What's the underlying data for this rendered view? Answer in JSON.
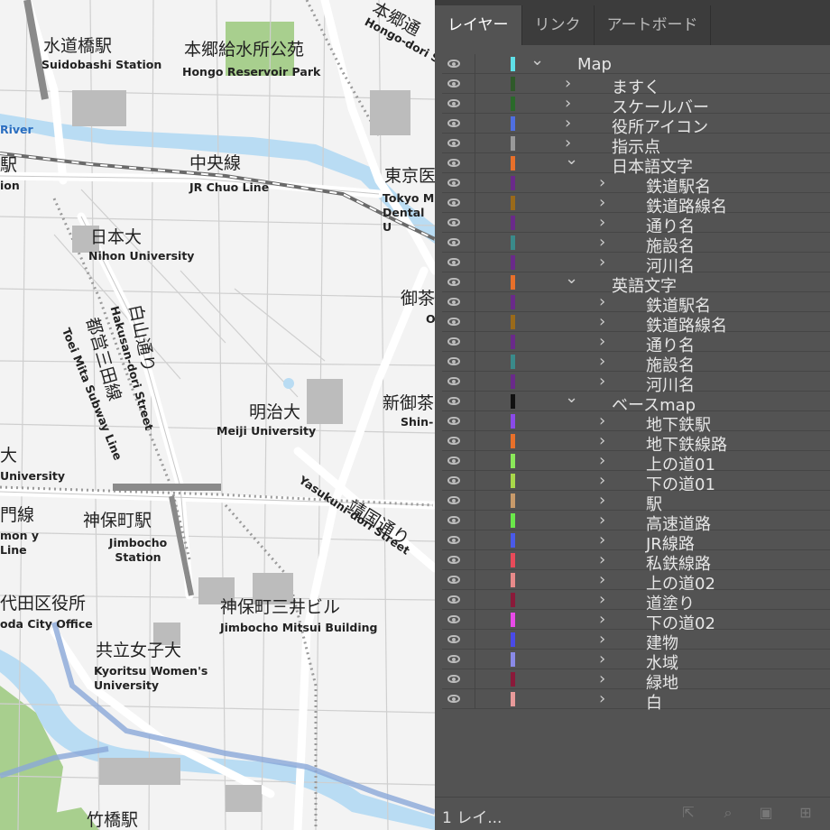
{
  "map": {
    "labels": [
      {
        "jp": "水道橋駅",
        "en": "Suidobashi Station"
      },
      {
        "jp": "本郷給水所公苑",
        "en": "Hongo Reservoir Park"
      },
      {
        "jp": "本郷通",
        "en": "Hongo-dori S"
      },
      {
        "jp": "中央線",
        "en": "JR Chuo Line"
      },
      {
        "jp": "東京医",
        "en": "Tokyo M Dental U"
      },
      {
        "jp": "日本大",
        "en": "Nihon University"
      },
      {
        "jp": "白山通り",
        "en": "Hakusan-dori Street"
      },
      {
        "jp": "都営三田線",
        "en": "Toei Mita Subway Line"
      },
      {
        "jp": "明治大",
        "en": "Meiji University"
      },
      {
        "jp": "御茶",
        "en": "O"
      },
      {
        "jp": "新御茶",
        "en": "Shin-"
      },
      {
        "jp": "靖国通り",
        "en": "Yasukuni-dori Street"
      },
      {
        "jp": "神保町駅",
        "en": "Jimbocho Station"
      },
      {
        "jp": "神保町三井ビル",
        "en": "Jimbocho Mitsui Building"
      },
      {
        "jp": "代田区役所",
        "en": "oda City Office"
      },
      {
        "jp": "共立女子大",
        "en": "Kyoritsu Women's University"
      },
      {
        "jp": "竹橋駅",
        "en": ""
      },
      {
        "jp": "門線",
        "en": "mon y Line"
      },
      {
        "jp": "駅",
        "en": "ion"
      },
      {
        "jp": "大",
        "en": "University"
      },
      {
        "jp": "",
        "en": "River"
      }
    ]
  },
  "panel": {
    "tabs": [
      "レイヤー",
      "リンク",
      "アートボード"
    ],
    "layers": [
      {
        "name": "Map",
        "color": "#5fe0e8",
        "level": 0,
        "expanded": true
      },
      {
        "name": "ますく",
        "color": "#2f5a2a",
        "level": 1,
        "expanded": false
      },
      {
        "name": "スケールバー",
        "color": "#2a6a2a",
        "level": 1,
        "expanded": false
      },
      {
        "name": "役所アイコン",
        "color": "#4f6fe0",
        "level": 1,
        "expanded": false
      },
      {
        "name": "指示点",
        "color": "#9a9a9a",
        "level": 1,
        "expanded": false
      },
      {
        "name": "日本語文字",
        "color": "#e8702a",
        "level": 1,
        "expanded": true
      },
      {
        "name": "鉄道駅名",
        "color": "#6a2a8a",
        "level": 2,
        "expanded": false
      },
      {
        "name": "鉄道路線名",
        "color": "#9a6a1a",
        "level": 2,
        "expanded": false
      },
      {
        "name": "通り名",
        "color": "#6a2a8a",
        "level": 2,
        "expanded": false
      },
      {
        "name": "施設名",
        "color": "#3a8a8a",
        "level": 2,
        "expanded": false
      },
      {
        "name": "河川名",
        "color": "#6a2a8a",
        "level": 2,
        "expanded": false
      },
      {
        "name": "英語文字",
        "color": "#e8702a",
        "level": 1,
        "expanded": true
      },
      {
        "name": "鉄道駅名",
        "color": "#6a2a8a",
        "level": 2,
        "expanded": false
      },
      {
        "name": "鉄道路線名",
        "color": "#9a6a1a",
        "level": 2,
        "expanded": false
      },
      {
        "name": "通り名",
        "color": "#6a2a8a",
        "level": 2,
        "expanded": false
      },
      {
        "name": "施設名",
        "color": "#3a8a8a",
        "level": 2,
        "expanded": false
      },
      {
        "name": "河川名",
        "color": "#6a2a8a",
        "level": 2,
        "expanded": false
      },
      {
        "name": "ベースmap",
        "color": "#111111",
        "level": 1,
        "expanded": true
      },
      {
        "name": "地下鉄駅",
        "color": "#8a4ae8",
        "level": 2,
        "expanded": false
      },
      {
        "name": "地下鉄線路",
        "color": "#e8702a",
        "level": 2,
        "expanded": false
      },
      {
        "name": "上の道01",
        "color": "#8ae85a",
        "level": 2,
        "expanded": false
      },
      {
        "name": "下の道01",
        "color": "#a8d84a",
        "level": 2,
        "expanded": false
      },
      {
        "name": "駅",
        "color": "#c89a6a",
        "level": 2,
        "expanded": false
      },
      {
        "name": "高速道路",
        "color": "#6ae84a",
        "level": 2,
        "expanded": false
      },
      {
        "name": "JR線路",
        "color": "#4a5ae8",
        "level": 2,
        "expanded": false
      },
      {
        "name": "私鉄線路",
        "color": "#e84a5a",
        "level": 2,
        "expanded": false
      },
      {
        "name": "上の道02",
        "color": "#e88a8a",
        "level": 2,
        "expanded": false
      },
      {
        "name": "道塗り",
        "color": "#8a1a3a",
        "level": 2,
        "expanded": false
      },
      {
        "name": "下の道02",
        "color": "#e84ae8",
        "level": 2,
        "expanded": false
      },
      {
        "name": "建物",
        "color": "#4a4ae8",
        "level": 2,
        "expanded": false
      },
      {
        "name": "水域",
        "color": "#8a8ae8",
        "level": 2,
        "expanded": false
      },
      {
        "name": "緑地",
        "color": "#8a1a3a",
        "level": 2,
        "expanded": false
      },
      {
        "name": "白",
        "color": "#e89a9a",
        "level": 2,
        "expanded": false
      }
    ],
    "footer_count": "1 レイ..."
  }
}
